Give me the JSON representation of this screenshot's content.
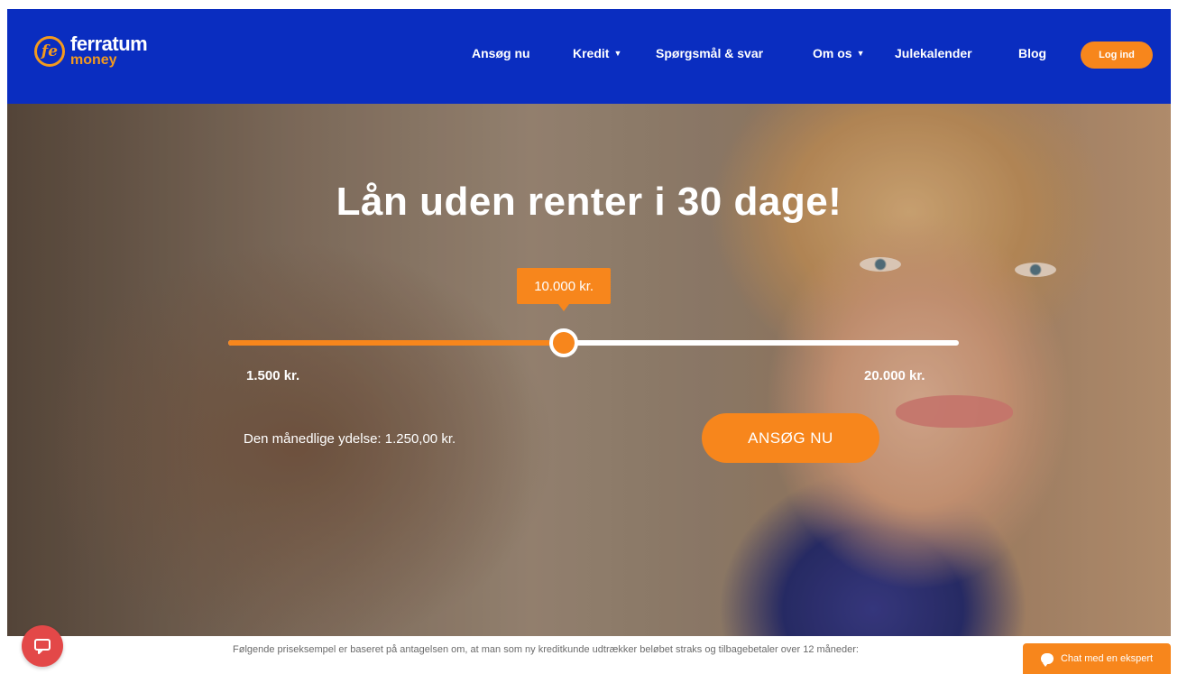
{
  "brand": {
    "mark": "fe",
    "name_top": "ferratum",
    "name_bottom": "money"
  },
  "nav": {
    "items": [
      {
        "label": "Ansøg nu",
        "dropdown": false
      },
      {
        "label": "Kredit",
        "dropdown": true
      },
      {
        "label": "Spørgsmål & svar",
        "dropdown": false
      },
      {
        "label": "Om os",
        "dropdown": true
      },
      {
        "label": "Julekalender",
        "dropdown": false
      },
      {
        "label": "Blog",
        "dropdown": false
      }
    ],
    "login_label": "Log ind"
  },
  "hero": {
    "title": "Lån uden renter i 30 dage!",
    "slider": {
      "value_label": "10.000 kr.",
      "value": 10000,
      "min": 1500,
      "max": 20000,
      "min_label": "1.500 kr.",
      "max_label": "20.000 kr."
    },
    "monthly_text": "Den månedlige ydelse: 1.250,00 kr.",
    "apply_label": "ANSØG NU"
  },
  "footer": {
    "disclaimer": "Følgende priseksempel er baseret på antagelsen om, at man som ny kreditkunde udtrækker beløbet straks og tilbagebetaler over 12 måneder:",
    "chat_label": "Chat med en ekspert"
  },
  "colors": {
    "nav_bg": "#0a2dc0",
    "accent": "#f7861c",
    "feedback": "#e34848"
  },
  "icons": {
    "feedback": "chat-bubble-icon",
    "chat": "speech-bubble-icon",
    "dropdown": "caret-down-icon"
  }
}
